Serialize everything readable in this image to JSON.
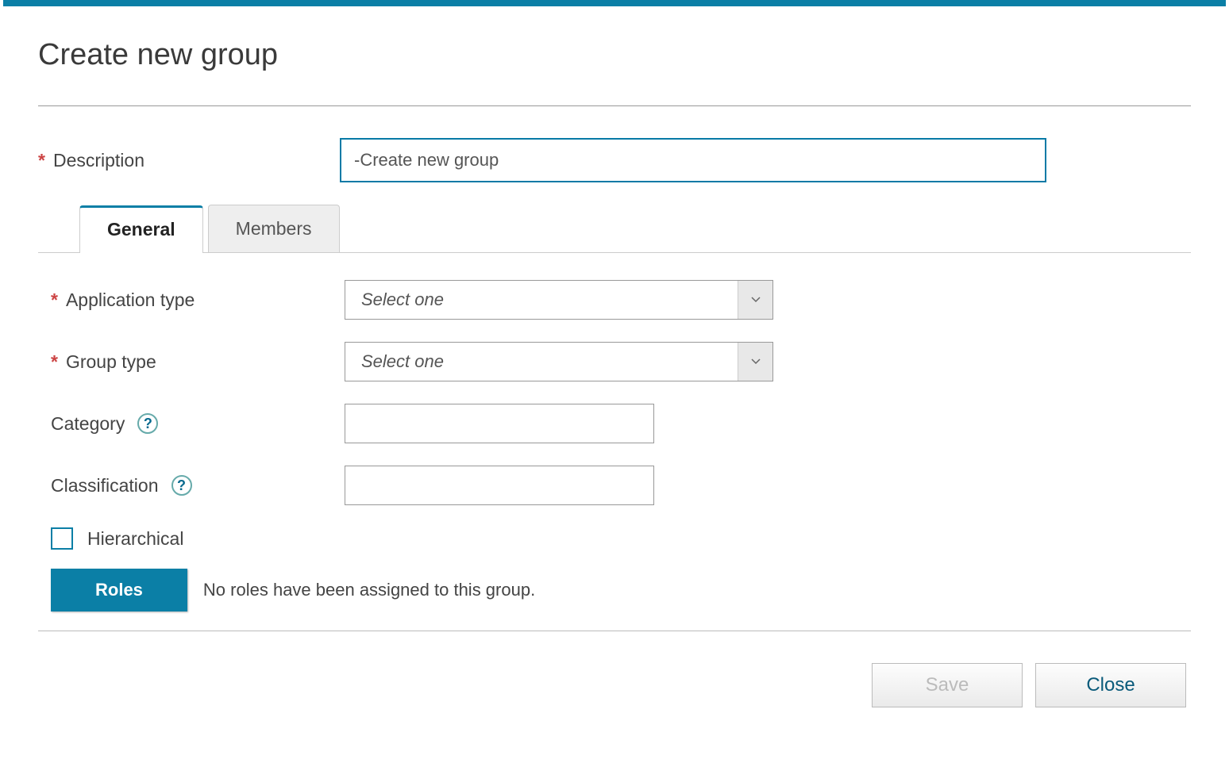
{
  "title": "Create new group",
  "fields": {
    "description_label": "Description",
    "description_value": "-Create new group",
    "app_type_label": "Application type",
    "app_type_placeholder": "Select one",
    "group_type_label": "Group type",
    "group_type_placeholder": "Select one",
    "category_label": "Category",
    "classification_label": "Classification",
    "hierarchical_label": "Hierarchical"
  },
  "tabs": {
    "general": "General",
    "members": "Members"
  },
  "roles": {
    "button": "Roles",
    "empty_text": "No roles have been assigned to this group."
  },
  "footer": {
    "save": "Save",
    "close": "Close"
  },
  "help_icon_text": "?"
}
